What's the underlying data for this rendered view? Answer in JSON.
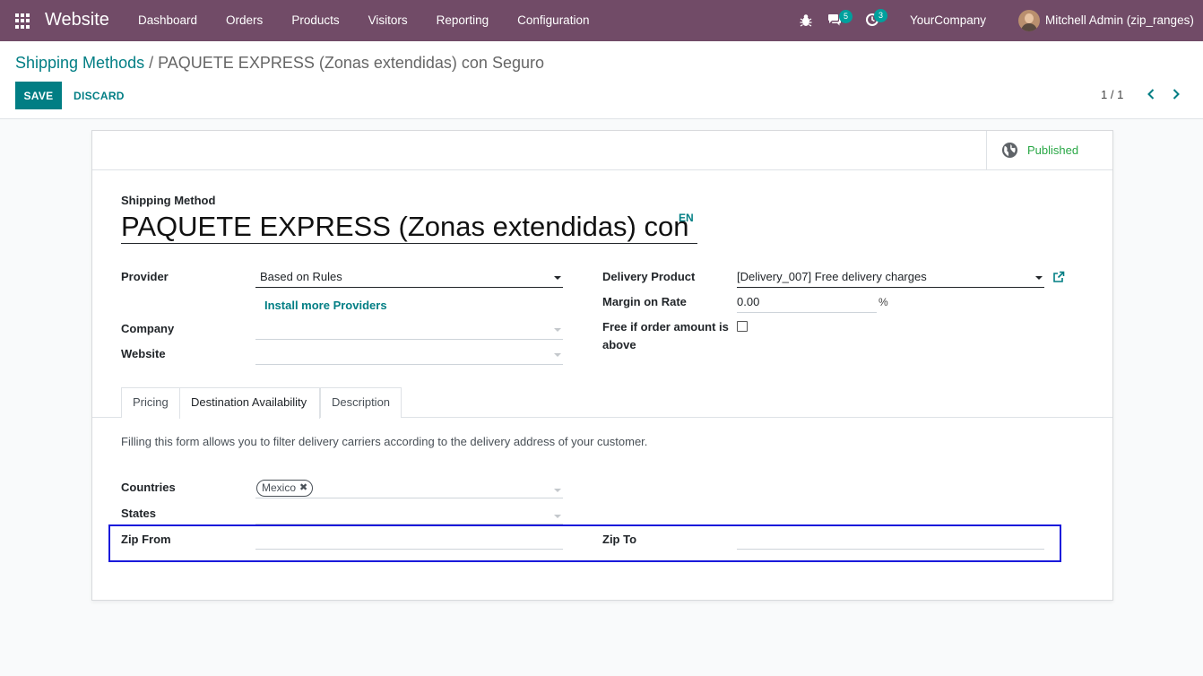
{
  "navbar": {
    "app_name": "Website",
    "menu": [
      "Dashboard",
      "Orders",
      "Products",
      "Visitors",
      "Reporting",
      "Configuration"
    ],
    "chat_count": "5",
    "activity_count": "3",
    "company": "YourCompany",
    "user": "Mitchell Admin (zip_ranges)",
    "color": "#714b67",
    "badge_color": "#00a09d"
  },
  "control_panel": {
    "breadcrumb_parent": "Shipping Methods",
    "breadcrumb_separator": " / ",
    "breadcrumb_current": "PAQUETE EXPRESS (Zonas extendidas) con Seguro",
    "save_label": "SAVE",
    "discard_label": "DISCARD",
    "pager": "1 / 1",
    "accent_color": "#017e84"
  },
  "form": {
    "published_label": "Published",
    "title_label": "Shipping Method",
    "title_value": "PAQUETE EXPRESS (Zonas extendidas) con Seguro",
    "lang": "EN",
    "left": {
      "provider_label": "Provider",
      "provider_value": "Based on Rules",
      "install_providers": "Install more Providers",
      "company_label": "Company",
      "company_value": "",
      "website_label": "Website",
      "website_value": ""
    },
    "right": {
      "delivery_product_label": "Delivery Product",
      "delivery_product_value": "[Delivery_007] Free delivery charges",
      "margin_label": "Margin on Rate",
      "margin_value": "0.00",
      "margin_unit": "%",
      "free_label_line1": "Free if order amount is",
      "free_label_line2": "above",
      "free_checked": false
    },
    "tabs": [
      "Pricing",
      "Destination Availability",
      "Description"
    ],
    "active_tab": "Destination Availability",
    "destination": {
      "info": "Filling this form allows you to filter delivery carriers according to the delivery address of your customer.",
      "countries_label": "Countries",
      "countries_tags": [
        "Mexico"
      ],
      "states_label": "States",
      "zip_from_label": "Zip From",
      "zip_from_value": "",
      "zip_to_label": "Zip To",
      "zip_to_value": ""
    }
  }
}
